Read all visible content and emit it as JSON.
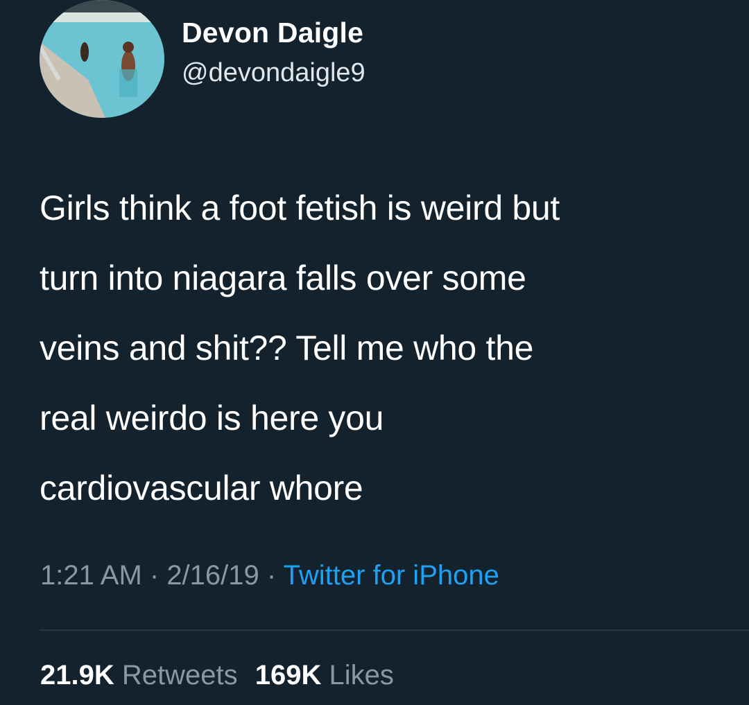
{
  "tweet": {
    "author": {
      "name": "Devon Daigle",
      "handle": "@devondaigle9",
      "avatar_icon": "profile-photo-pool"
    },
    "text": "Girls think a foot fetish is weird but\nturn into niagara falls over some\nveins and shit?? Tell me who the\nreal weirdo is here you\ncardiovascular whore",
    "time": "1:21 AM",
    "date": "2/16/19",
    "separator": " · ",
    "source": "Twitter for iPhone",
    "retweets_count": "21.9K",
    "retweets_label": "Retweets",
    "likes_count": "169K",
    "likes_label": "Likes"
  },
  "colors": {
    "background": "#15202b",
    "link": "#1da1f2",
    "secondary_text": "#8899a6"
  }
}
